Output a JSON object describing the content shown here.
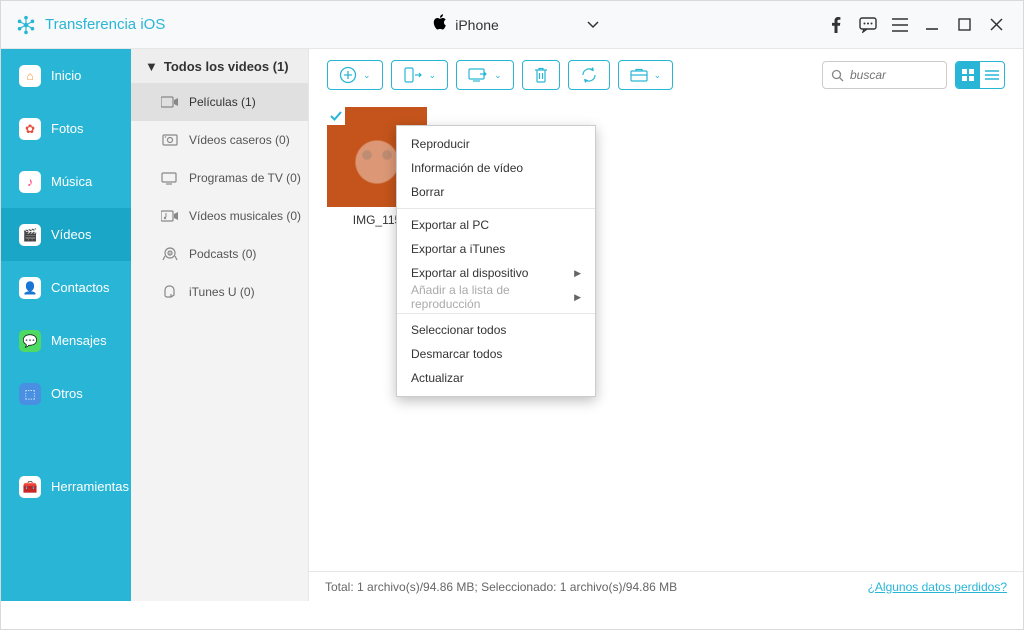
{
  "brand": {
    "title": "Transferencia iOS"
  },
  "device": {
    "name": "iPhone"
  },
  "sidebar": {
    "items": [
      {
        "label": "Inicio",
        "icon_bg": "#ffffff",
        "icon_fg": "#ff9933",
        "glyph": "⌂"
      },
      {
        "label": "Fotos",
        "icon_bg": "#ffffff",
        "icon_fg": "#e74c3c",
        "glyph": "✿"
      },
      {
        "label": "Música",
        "icon_bg": "#ffffff",
        "icon_fg": "#ff3366",
        "glyph": "♪"
      },
      {
        "label": "Vídeos",
        "icon_bg": "#ffffff",
        "icon_fg": "#a259d9",
        "glyph": "🎬",
        "active": true
      },
      {
        "label": "Contactos",
        "icon_bg": "#ffffff",
        "icon_fg": "#f5a623",
        "glyph": "👤"
      },
      {
        "label": "Mensajes",
        "icon_bg": "#4cd964",
        "icon_fg": "#ffffff",
        "glyph": "💬"
      },
      {
        "label": "Otros",
        "icon_bg": "#4a90e2",
        "icon_fg": "#ffffff",
        "glyph": "⬚"
      },
      {
        "label": "Herramientas",
        "icon_bg": "#ffffff",
        "icon_fg": "#888888",
        "glyph": "🧰"
      }
    ]
  },
  "subpanel": {
    "header": "Todos los videos (1)",
    "items": [
      {
        "label": "Películas (1)",
        "active": true
      },
      {
        "label": "Vídeos caseros (0)"
      },
      {
        "label": "Programas de TV (0)"
      },
      {
        "label": "Vídeos musicales (0)"
      },
      {
        "label": "Podcasts (0)"
      },
      {
        "label": "iTunes U (0)"
      }
    ]
  },
  "search": {
    "placeholder": "buscar"
  },
  "grid": {
    "item": {
      "label": "IMG_115",
      "checked": true
    }
  },
  "context_menu": [
    {
      "label": "Reproducir"
    },
    {
      "label": "Información de vídeo"
    },
    {
      "label": "Borrar"
    },
    {
      "sep": true
    },
    {
      "label": "Exportar al PC"
    },
    {
      "label": "Exportar a iTunes"
    },
    {
      "label": "Exportar al dispositivo",
      "submenu": true
    },
    {
      "label": "Añadir a la lista de reproducción",
      "submenu": true,
      "disabled": true
    },
    {
      "sep": true
    },
    {
      "label": "Seleccionar todos"
    },
    {
      "label": "Desmarcar todos"
    },
    {
      "label": "Actualizar"
    }
  ],
  "status": {
    "text": "Total: 1 archivo(s)/94.86 MB; Seleccionado: 1 archivo(s)/94.86 MB",
    "link": "¿Algunos datos perdidos?"
  }
}
